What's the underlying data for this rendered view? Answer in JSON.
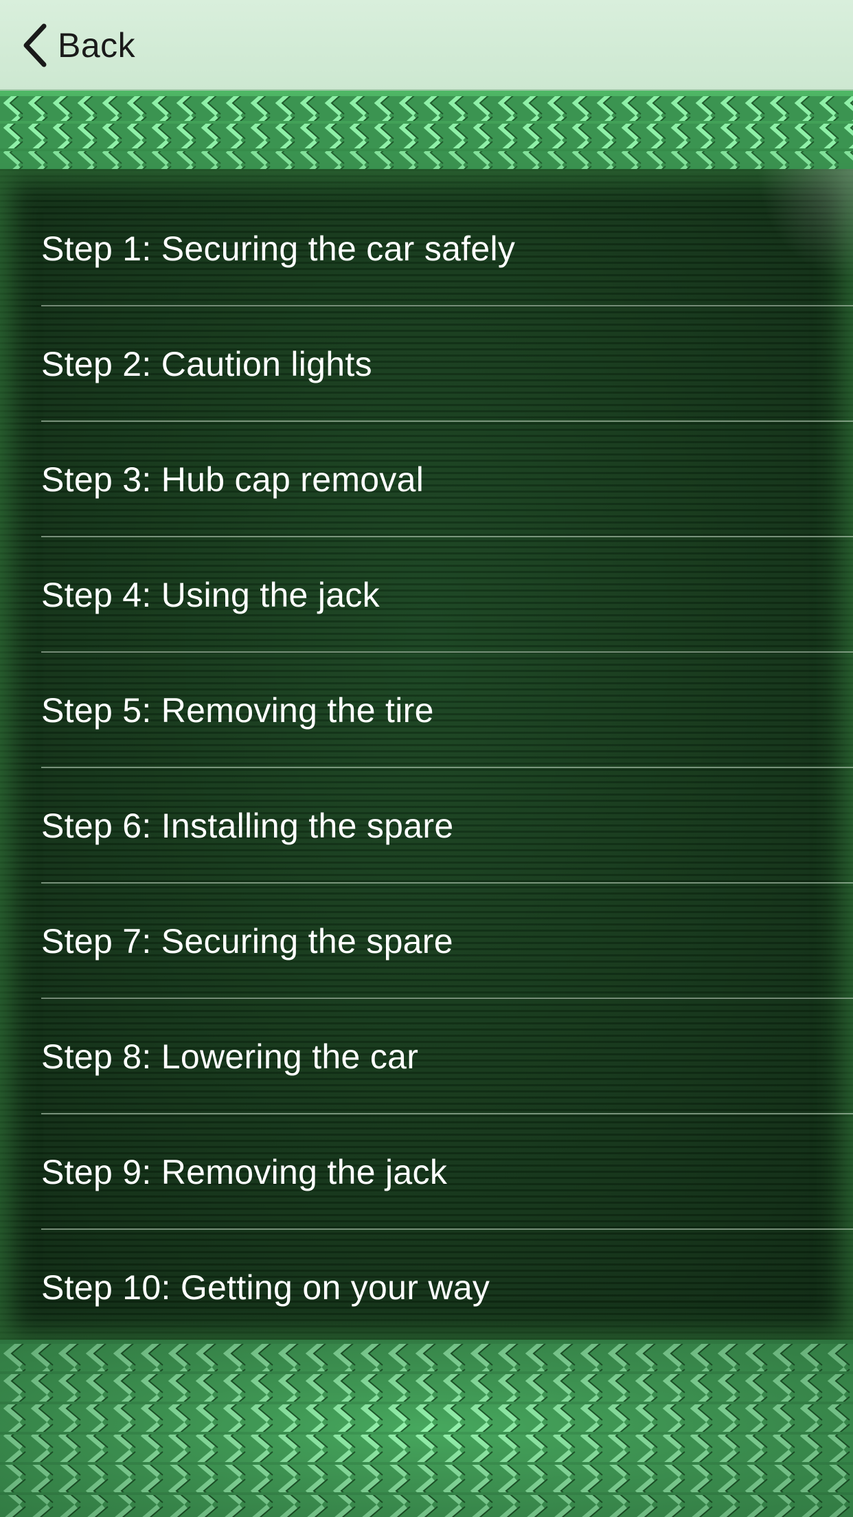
{
  "navbar": {
    "back_label": "Back",
    "back_icon": "chevron-left-icon"
  },
  "steps": [
    {
      "label": "Step 1: Securing the car safely"
    },
    {
      "label": "Step 2: Caution lights"
    },
    {
      "label": "Step 3: Hub cap removal"
    },
    {
      "label": "Step 4: Using the jack"
    },
    {
      "label": "Step 5: Removing the tire"
    },
    {
      "label": "Step 6: Installing the spare"
    },
    {
      "label": "Step 7: Securing the spare"
    },
    {
      "label": "Step 8: Lowering the car"
    },
    {
      "label": "Step 9: Removing the jack"
    },
    {
      "label": "Step 10: Getting on your way"
    }
  ],
  "colors": {
    "navbar_bg": "#d9efdc",
    "panel_bg": "#163a1c",
    "tread_light": "#7fe59a",
    "tread_dark": "#2f7a43",
    "text": "#ffffff"
  }
}
